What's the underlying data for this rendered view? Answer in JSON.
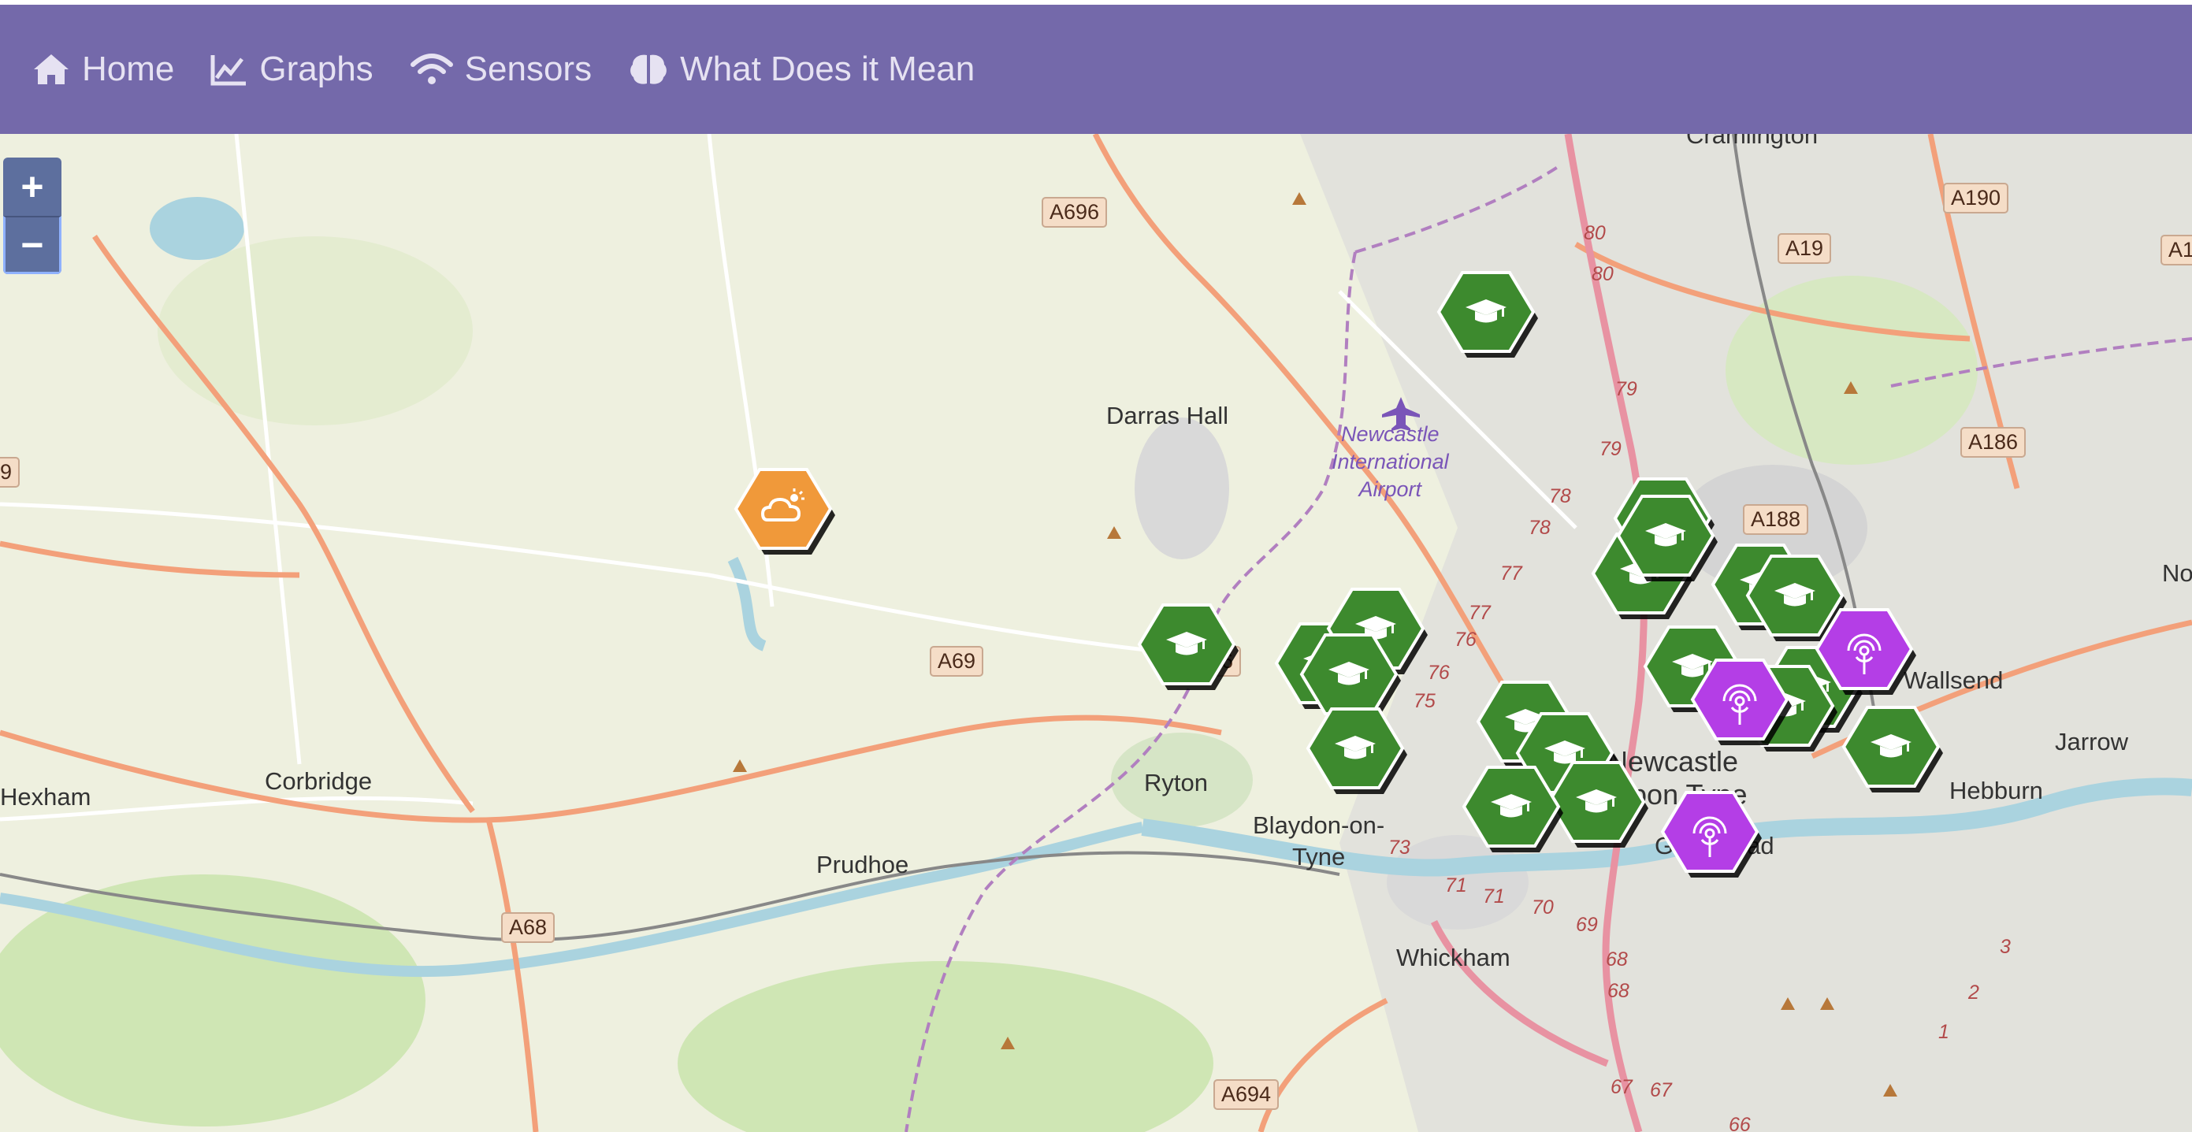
{
  "navbar": {
    "items": [
      {
        "label": "Home",
        "icon": "home-icon"
      },
      {
        "label": "Graphs",
        "icon": "area-chart-icon"
      },
      {
        "label": "Sensors",
        "icon": "wifi-icon"
      },
      {
        "label": "What Does it Mean",
        "icon": "brain-icon"
      }
    ]
  },
  "zoom": {
    "in_label": "+",
    "out_label": "−"
  },
  "colors": {
    "navbar": "#7469aa",
    "school_marker": "#3d8a2e",
    "weather_marker": "#f0993a",
    "sensor_marker": "#b43ee6"
  },
  "map": {
    "places": [
      "Cramlington",
      "Darras Hall",
      "Hexham",
      "Corbridge",
      "Prudhoe",
      "Ryton",
      "Blaydon-on-",
      "Tyne",
      "Newcastle",
      "upon Tyne",
      "Gateshead",
      "Whickham",
      "Wallsend",
      "Jarrow",
      "Hebburn",
      "No"
    ],
    "airport": [
      "Newcastle",
      "International",
      "Airport"
    ],
    "roads": [
      "A696",
      "A69",
      "A68",
      "A694",
      "A190",
      "A19",
      "A186",
      "A188",
      "A1",
      "9",
      "6"
    ],
    "junctions": [
      "80",
      "80",
      "79",
      "79",
      "78",
      "78",
      "77",
      "77",
      "76",
      "76",
      "75",
      "73",
      "71",
      "71",
      "70",
      "69",
      "68",
      "68",
      "67",
      "67",
      "66",
      "3",
      "2",
      "1"
    ]
  }
}
